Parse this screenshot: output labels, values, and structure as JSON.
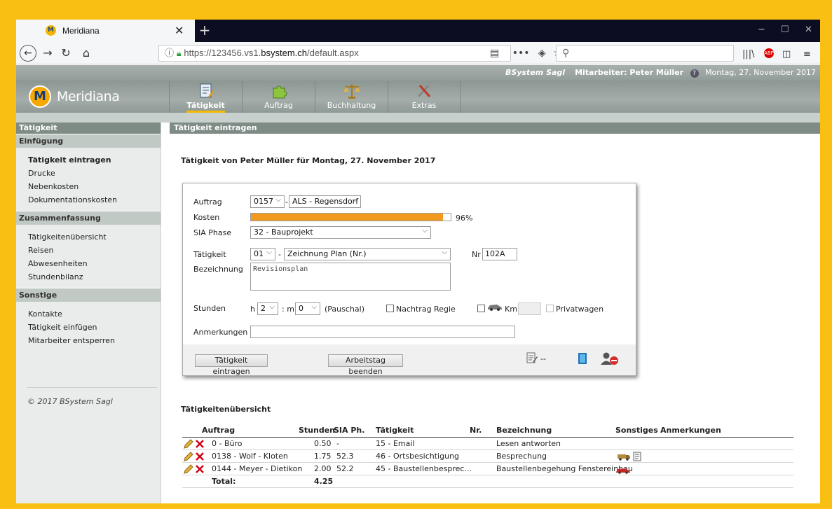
{
  "browser": {
    "tab_title": "Meridiana",
    "tab_logo": "M",
    "url_prefix": "https://123456.vs1.",
    "url_host": "bsystem.ch",
    "url_path": "/default.aspx",
    "search_placeholder": ""
  },
  "header": {
    "company": "BSystem Sagl",
    "employee_label": "Mitarbeiter: Peter Müller",
    "date": "Montag, 27. November 2017",
    "brand": "Meridiana",
    "brand_logo": "M"
  },
  "menu": [
    {
      "label": "Tätigkeit",
      "icon": "notepad-icon",
      "active": true
    },
    {
      "label": "Auftrag",
      "icon": "puzzle-icon",
      "active": false
    },
    {
      "label": "Buchhaltung",
      "icon": "scales-icon",
      "active": false
    },
    {
      "label": "Extras",
      "icon": "tools-icon",
      "active": false
    }
  ],
  "sidebar": {
    "title": "Tätigkeit",
    "sections": [
      {
        "title": "Einfügung",
        "items": [
          "Tätigkeit eintragen",
          "Drucke",
          "Nebenkosten",
          "Dokumentationskosten"
        ]
      },
      {
        "title": "Zusammenfassung",
        "items": [
          "Tätigkeitenübersicht",
          "Reisen",
          "Abwesenheiten",
          "Stundenbilanz"
        ]
      },
      {
        "title": "Sonstige",
        "items": [
          "Kontakte",
          "Tätigkeit einfügen",
          "Mitarbeiter entsperren"
        ]
      }
    ],
    "footer": "© 2017 BSystem Sagl"
  },
  "main": {
    "header": "Tätigkeit eintragen",
    "page_title": "Tätigkeit von Peter Müller für Montag, 27. November 2017"
  },
  "form": {
    "auftrag_label": "Auftrag",
    "auftrag_code": "0157",
    "auftrag_sep": "-",
    "auftrag_name": "ALS - Regensdorf",
    "kosten_label": "Kosten",
    "kosten_pct": "96%",
    "kosten_value": 0.96,
    "sia_label": "SIA Phase",
    "sia_value": "32 - Bauprojekt",
    "taetigkeit_label": "Tätigkeit",
    "taetigkeit_code": "01",
    "taetigkeit_sep": "-",
    "taetigkeit_name": "Zeichnung Plan (Nr.)",
    "nr_label": "Nr",
    "nr_value": "102A",
    "bezeichnung_label": "Bezeichnung",
    "bezeichnung_value": "Revisionsplan",
    "stunden_label": "Stunden",
    "h_label": "h",
    "h_value": "2",
    "m_label": ": m",
    "m_value": "0",
    "pauschal_label": "(Pauschal)",
    "nachtrag_label": "Nachtrag Regie",
    "km_label": "Km",
    "km_value": "",
    "privatwagen_label": "Privatwagen",
    "anmerkungen_label": "Anmerkungen",
    "anmerkungen_value": "",
    "submit_label": "Tätigkeit eintragen",
    "end_day_label": "Arbeitstag beenden",
    "note_status": "--"
  },
  "overview": {
    "title": "Tätigkeitenübersicht",
    "columns": [
      "Auftrag",
      "Stunden",
      "SIA Ph.",
      "Tätigkeit",
      "Nr.",
      "Bezeichnung",
      "Sonstiges",
      "Anmerkungen"
    ],
    "rows": [
      {
        "auftrag": "0 - Büro",
        "stunden": "0.50",
        "sia": "-",
        "taetigkeit": "15 - Email",
        "nr": "",
        "bezeichnung": "Lesen antworten",
        "sonstiges": []
      },
      {
        "auftrag": "0138 - Wolf - Kloten",
        "stunden": "1.75",
        "sia": "52.3",
        "taetigkeit": "46 - Ortsbesichtigung",
        "nr": "",
        "bezeichnung": "Besprechung",
        "sonstiges": [
          "van-icon",
          "note-icon"
        ]
      },
      {
        "auftrag": "0144 - Meyer - Dietikon",
        "stunden": "2.00",
        "sia": "52.2",
        "taetigkeit": "45 - Baustellenbesprec...",
        "nr": "",
        "bezeichnung": "Baustellenbegehung Fenstereinbau",
        "sonstiges": [
          "car-icon"
        ]
      }
    ],
    "total_label": "Total:",
    "total_value": "4.25"
  },
  "colors": {
    "accent": "#f9c013",
    "progress": "#f29a1f",
    "header": "#7f8c86"
  }
}
